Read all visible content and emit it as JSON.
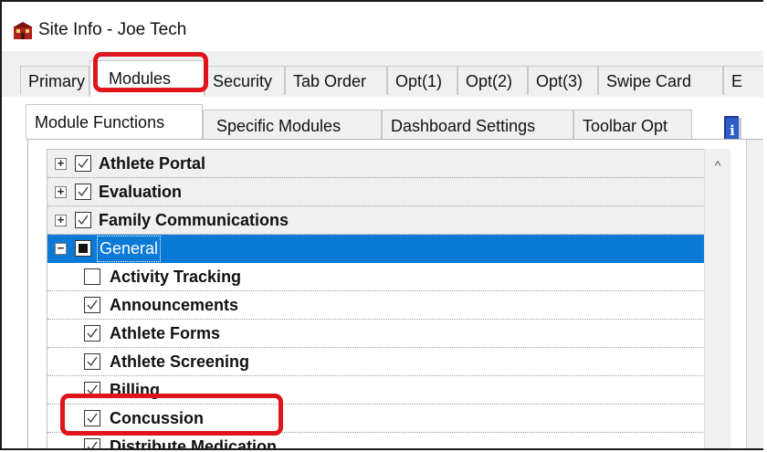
{
  "window": {
    "title": "Site Info - Joe Tech",
    "app_icon": "building-icon"
  },
  "main_tabs": [
    {
      "label": "Primary",
      "active": false
    },
    {
      "label": "Modules",
      "active": true
    },
    {
      "label": "Security",
      "active": false
    },
    {
      "label": "Tab Order",
      "active": false
    },
    {
      "label": "Opt(1)",
      "active": false
    },
    {
      "label": "Opt(2)",
      "active": false
    },
    {
      "label": "Opt(3)",
      "active": false
    },
    {
      "label": "Swipe Card",
      "active": false
    },
    {
      "label": "E",
      "active": false
    }
  ],
  "sub_tabs": [
    {
      "label": "Module Functions",
      "active": true
    },
    {
      "label": "Specific Modules",
      "active": false
    },
    {
      "label": "Dashboard Settings",
      "active": false
    },
    {
      "label": "Toolbar Opt",
      "active": false
    }
  ],
  "info_button_icon": "info-book-icon",
  "tree": {
    "groups": [
      {
        "label": "Athlete Portal",
        "expanded": false,
        "checked": true
      },
      {
        "label": "Evaluation",
        "expanded": false,
        "checked": true
      },
      {
        "label": "Family Communications",
        "expanded": false,
        "checked": true
      },
      {
        "label": "General",
        "expanded": true,
        "checked": "partial",
        "selected": true
      }
    ],
    "children": [
      {
        "label": "Activity Tracking",
        "checked": false
      },
      {
        "label": "Announcements",
        "checked": true
      },
      {
        "label": "Athlete Forms",
        "checked": true
      },
      {
        "label": "Athlete Screening",
        "checked": true
      },
      {
        "label": "Billing",
        "checked": true
      },
      {
        "label": "Concussion",
        "checked": true
      },
      {
        "label": "Distribute Medication",
        "checked": true
      }
    ],
    "expander_collapsed": "+",
    "expander_expanded": "−"
  },
  "scroll_up_glyph": "^",
  "colors": {
    "selection": "#0a7ad6",
    "highlight": "#e0151b",
    "panel_bg": "#f0f0f0"
  }
}
